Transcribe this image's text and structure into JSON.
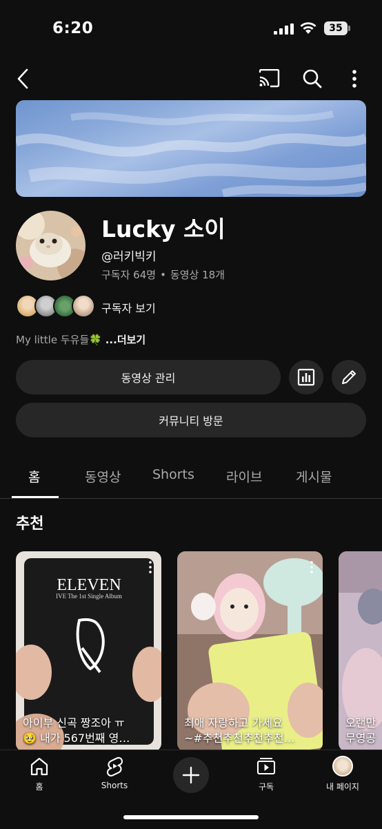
{
  "status_bar": {
    "time": "6:20",
    "battery": "35"
  },
  "channel": {
    "name": "Lucky 소이",
    "handle": "@러키빅키",
    "subscribers": "구독자 64명",
    "video_count": "동영상 18개",
    "separator": "•",
    "view_subscribers": "구독자 보기",
    "description": "My little 두유들🍀",
    "more": "...더보기"
  },
  "buttons": {
    "manage_videos": "동영상 관리",
    "visit_community": "커뮤니티 방문"
  },
  "tabs": [
    {
      "label": "홈"
    },
    {
      "label": "동영상"
    },
    {
      "label": "Shorts"
    },
    {
      "label": "라이브"
    },
    {
      "label": "게시물"
    }
  ],
  "section": {
    "title": "추천"
  },
  "shorts": [
    {
      "line1": "아이부 신곡 짱조아 ㅠ",
      "line2": "🥹 내가 567번째 영…",
      "album": "ELEVEN",
      "album_sub": "IVE The 1st Single Album"
    },
    {
      "line1": "최애 자랑하고 가세요",
      "line2": "~#추천추천추천추천…"
    },
    {
      "line1": "오랜만",
      "line2": "무영공"
    }
  ],
  "bottom_nav": {
    "home": "홈",
    "shorts": "Shorts",
    "subscriptions": "구독",
    "my_page": "내 페이지"
  }
}
